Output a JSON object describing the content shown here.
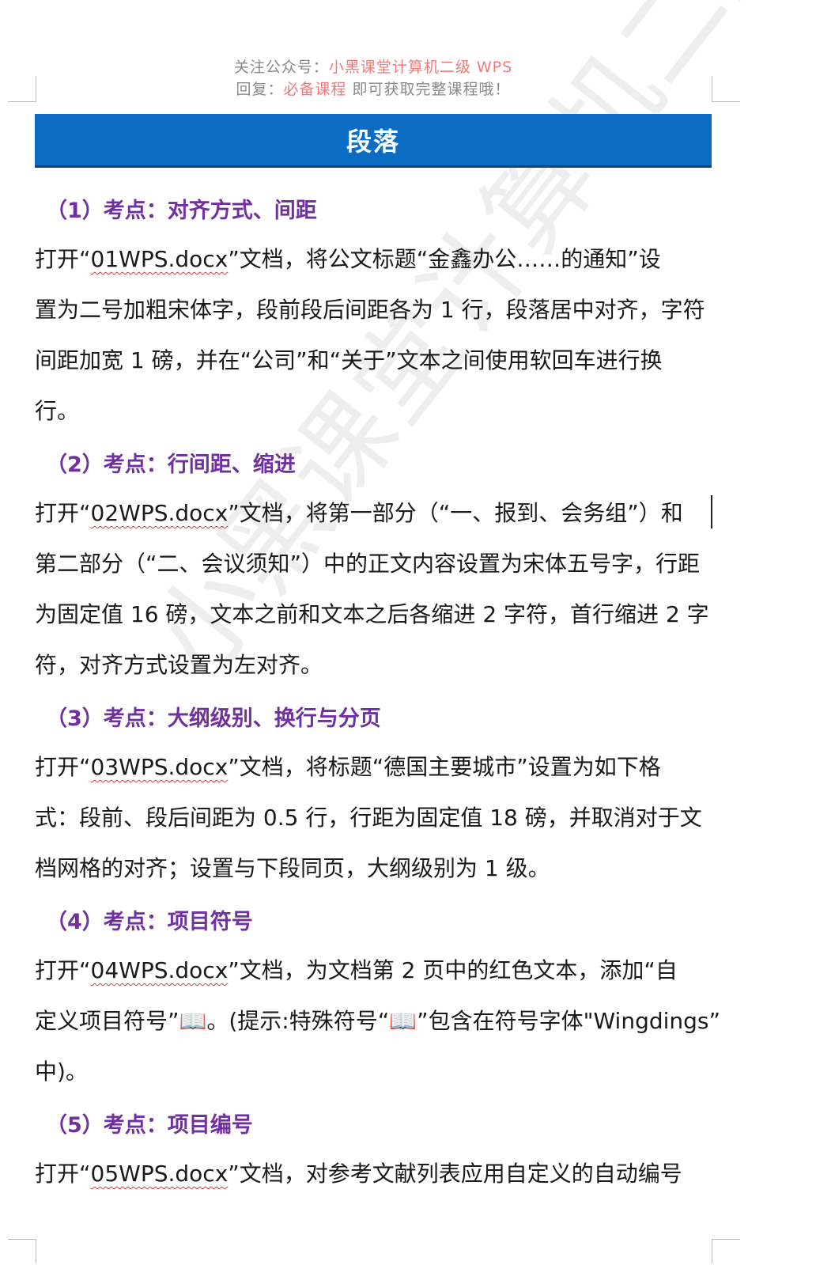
{
  "header": {
    "line1_prefix": "关注公众号：",
    "line1_highlight": "小黑课堂计算机二级 WPS",
    "line2_prefix": "回复：",
    "line2_highlight": "必备课程",
    "line2_suffix": " 即可获取完整课程哦！"
  },
  "title": "段落",
  "watermark": "小黑课堂计算机二级WPS",
  "sections": [
    {
      "heading": "（1）考点：对齐方式、间距",
      "lines": [
        {
          "pre": "打开“",
          "file": "01WPS.docx",
          "post": "”文档，将公文标题“金鑫办公……的通知”设"
        },
        {
          "text": "置为二号加粗宋体字，段前段后间距各为 1 行，段落居中对齐，字符"
        },
        {
          "text": "间距加宽 1 磅，并在“公司”和“关于”文本之间使用软回车进行换"
        },
        {
          "text": "行。"
        }
      ]
    },
    {
      "heading": "（2）考点：行间距、缩进",
      "lines": [
        {
          "pre": "打开“",
          "file": "02WPS.docx",
          "post": "”文档，将第一部分（“一、报到、会务组”）和"
        },
        {
          "text": "第二部分（“二、会议须知”）中的正文内容设置为宋体五号字，行距"
        },
        {
          "text": "为固定值 16 磅，文本之前和文本之后各缩进 2 字符，首行缩进 2 字"
        },
        {
          "text": "符，对齐方式设置为左对齐。"
        }
      ]
    },
    {
      "heading": "（3）考点：大纲级别、换行与分页",
      "lines": [
        {
          "pre": "打开“",
          "file": "03WPS.docx",
          "post": "”文档，将标题“德国主要城市”设置为如下格"
        },
        {
          "text": "式：段前、段后间距为 0.5 行，行距为固定值 18 磅，并取消对于文"
        },
        {
          "text": "档网格的对齐；设置与下段同页，大纲级别为 1 级。"
        }
      ]
    },
    {
      "heading": "（4）考点：项目符号",
      "lines": [
        {
          "pre": "打开“",
          "file": "04WPS.docx",
          "post": "”文档，为文档第 2 页中的红色文本，添加“自"
        },
        {
          "text": "定义项目符号”📖。(提示:特殊符号“📖”包含在符号字体\"Wingdings”"
        },
        {
          "text": "中)。"
        }
      ]
    },
    {
      "heading": "（5）考点：项目编号",
      "lines": [
        {
          "pre": "打开“",
          "file": "05WPS.docx",
          "post": "”文档，对参考文献列表应用自定义的自动编号"
        }
      ]
    }
  ]
}
